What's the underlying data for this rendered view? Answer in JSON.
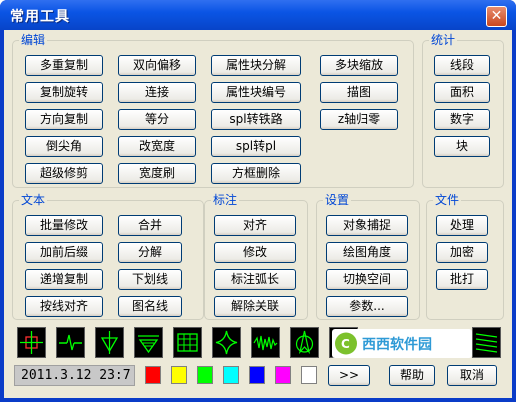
{
  "window": {
    "title": "常用工具",
    "close_label": "✕"
  },
  "groups": {
    "edit": "编辑",
    "stats": "统计",
    "text": "文本",
    "annotate": "标注",
    "settings": "设置",
    "file": "文件"
  },
  "edit_buttons": [
    "多重复制",
    "双向偏移",
    "属性块分解",
    "多块缩放",
    "复制旋转",
    "连接",
    "属性块编号",
    "描图",
    "方向复制",
    "等分",
    "spl转铁路",
    "z轴归零",
    "倒尖角",
    "改宽度",
    "spl转pl",
    "超级修剪",
    "宽度刷",
    "方框删除"
  ],
  "stats_buttons": [
    "线段",
    "面积",
    "数字",
    "块"
  ],
  "text_buttons": [
    "批量修改",
    "合并",
    "加前后缀",
    "分解",
    "递增复制",
    "下划线",
    "按线对齐",
    "图名线"
  ],
  "annotate_buttons": [
    "对齐",
    "修改",
    "标注弧长",
    "解除关联"
  ],
  "settings_buttons": [
    "对象捕捉",
    "绘图角度",
    "切换空间",
    "参数..."
  ],
  "file_buttons": [
    "处理",
    "加密",
    "批打"
  ],
  "icons": [
    "crosshair-icon",
    "line-break-icon",
    "triangle-fill-icon",
    "hatch-triangle-icon",
    "table-icon",
    "spline-icon",
    "wave-icon",
    "compass-icon",
    "arrow-left-icon",
    "stripes-icon"
  ],
  "status_text": "2011.3.12  23:7",
  "swatch_colors": [
    "#ff0000",
    "#ffff00",
    "#00ff00",
    "#00ffff",
    "#0000ff",
    "#ff00ff",
    "#ffffff"
  ],
  "bottom_buttons": {
    "more": ">>",
    "help": "帮助",
    "cancel": "取消"
  },
  "watermark_text": "西西软件园"
}
